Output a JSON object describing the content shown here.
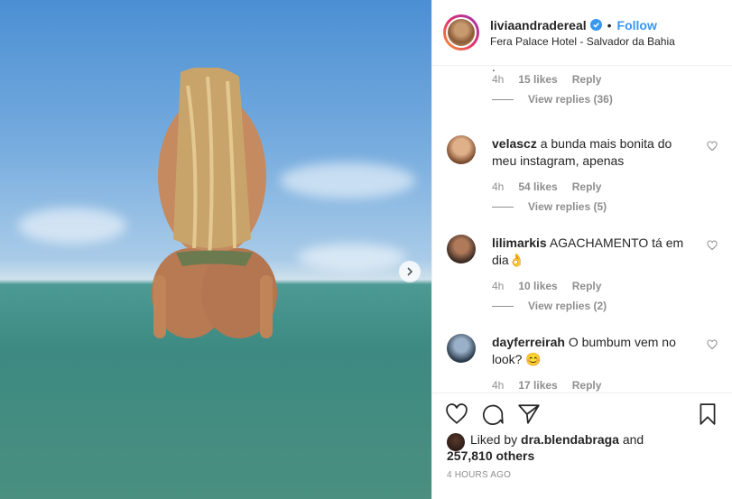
{
  "post": {
    "username": "liviaandradereal",
    "follow_label": "Follow",
    "dot": "•",
    "location": "Fera Palace Hotel - Salvador da Bahia"
  },
  "comments": [
    {
      "username": "",
      "text": ".",
      "time": "4h",
      "likes": "15 likes",
      "reply_label": "Reply",
      "replies": "View replies (36)"
    },
    {
      "username": "velascz",
      "text": "a bunda mais bonita do meu instagram, apenas",
      "time": "4h",
      "likes": "54 likes",
      "reply_label": "Reply",
      "replies": "View replies (5)"
    },
    {
      "username": "lilimarkis",
      "text": "AGACHAMENTO tá em dia👌",
      "time": "4h",
      "likes": "10 likes",
      "reply_label": "Reply",
      "replies": "View replies (2)"
    },
    {
      "username": "dayferreirah",
      "text": "O bumbum vem no look? 😊",
      "time": "4h",
      "likes": "17 likes",
      "reply_label": "Reply"
    }
  ],
  "likes_summary": {
    "prefix": "Liked by ",
    "liker": "dra.blendabraga",
    "middle": " and",
    "count": "257,810 others"
  },
  "timestamp": "4 HOURS AGO",
  "colors": {
    "accent": "#3897f0",
    "muted": "#8e8e8e",
    "text": "#262626"
  }
}
